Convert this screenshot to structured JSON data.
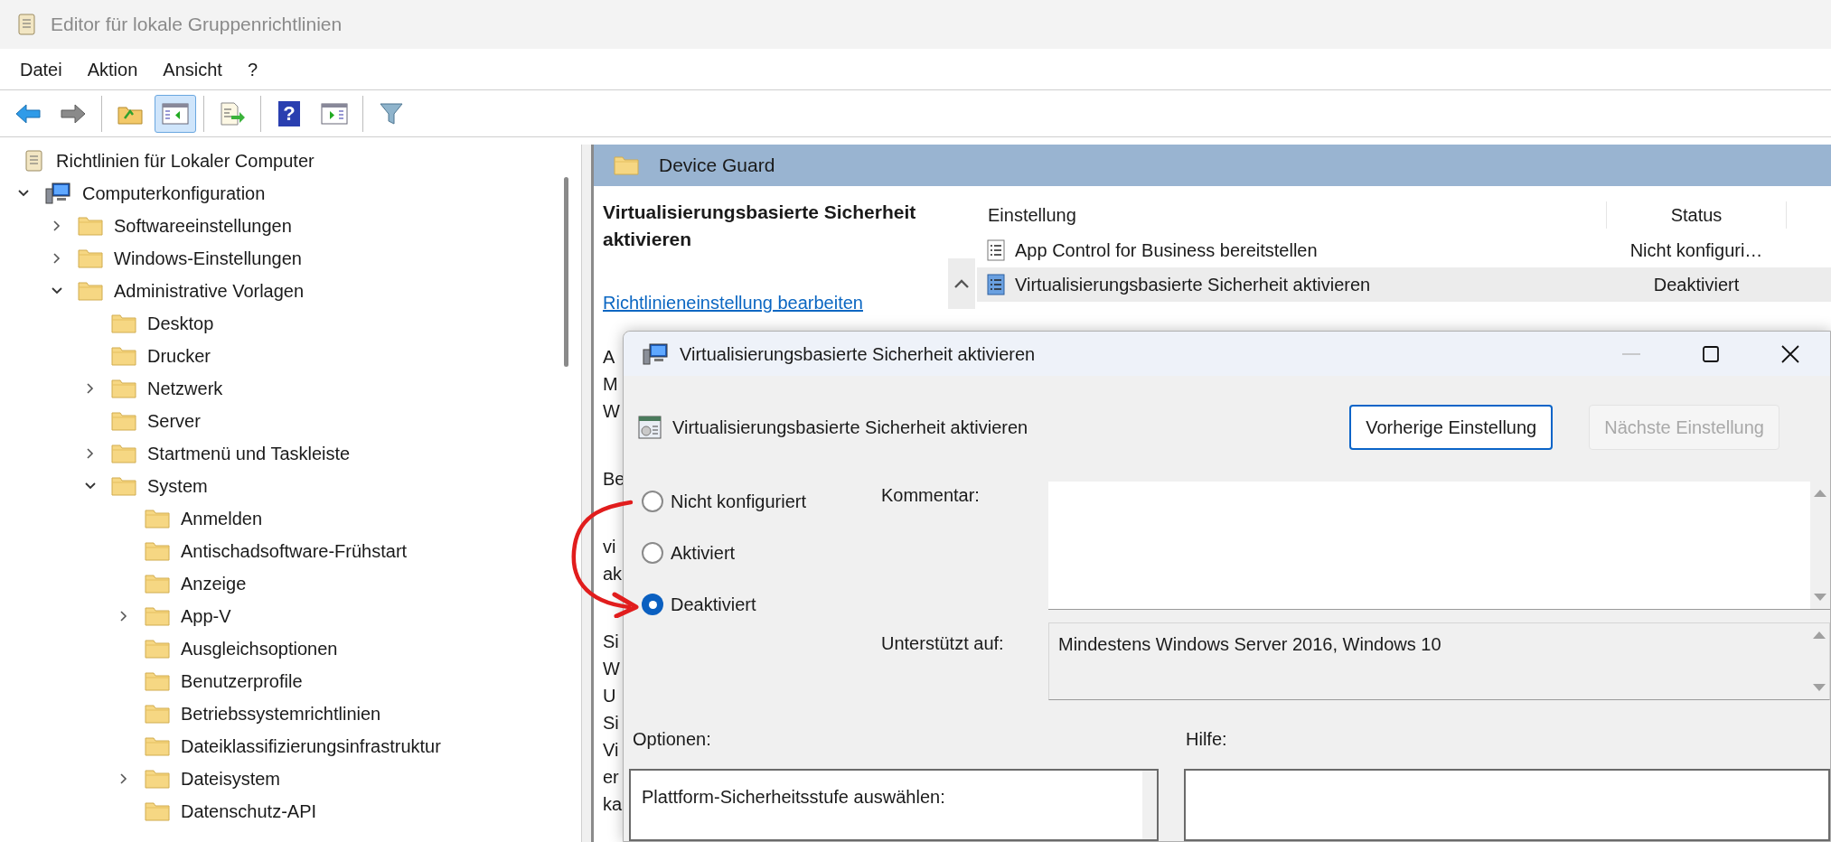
{
  "window": {
    "title": "Editor für lokale Gruppenrichtlinien"
  },
  "menu": [
    "Datei",
    "Aktion",
    "Ansicht",
    "?"
  ],
  "toolbar": [
    {
      "kind": "back",
      "selected": false
    },
    {
      "kind": "forward",
      "selected": false
    },
    {
      "kind": "separator"
    },
    {
      "kind": "folder_up",
      "selected": false
    },
    {
      "kind": "console_tree",
      "selected": true
    },
    {
      "kind": "separator"
    },
    {
      "kind": "export",
      "selected": false
    },
    {
      "kind": "separator"
    },
    {
      "kind": "help",
      "selected": false,
      "glyph": "?"
    },
    {
      "kind": "action_pane",
      "selected": false
    },
    {
      "kind": "separator"
    },
    {
      "kind": "filter",
      "selected": false
    }
  ],
  "tree": [
    {
      "label": "Richtlinien für Lokaler Computer",
      "kind": "policy",
      "children": [
        {
          "label": "Computerkonfiguration",
          "kind": "computer",
          "expanded": true,
          "children": [
            {
              "label": "Softwareeinstellungen",
              "kind": "folder",
              "expanded": false
            },
            {
              "label": "Windows-Einstellungen",
              "kind": "folder",
              "expanded": false
            },
            {
              "label": "Administrative Vorlagen",
              "kind": "folder",
              "expanded": true,
              "children": [
                {
                  "label": "Desktop",
                  "kind": "folder"
                },
                {
                  "label": "Drucker",
                  "kind": "folder"
                },
                {
                  "label": "Netzwerk",
                  "kind": "folder",
                  "expanded": false
                },
                {
                  "label": "Server",
                  "kind": "folder"
                },
                {
                  "label": "Startmenü und Taskleiste",
                  "kind": "folder",
                  "expanded": false
                },
                {
                  "label": "System",
                  "kind": "folder",
                  "expanded": true,
                  "children": [
                    {
                      "label": "Anmelden",
                      "kind": "folder"
                    },
                    {
                      "label": "Antischadsoftware-Frühstart",
                      "kind": "folder"
                    },
                    {
                      "label": "Anzeige",
                      "kind": "folder"
                    },
                    {
                      "label": "App-V",
                      "kind": "folder",
                      "expanded": false
                    },
                    {
                      "label": "Ausgleichsoptionen",
                      "kind": "folder"
                    },
                    {
                      "label": "Benutzerprofile",
                      "kind": "folder"
                    },
                    {
                      "label": "Betriebssystemrichtlinien",
                      "kind": "folder"
                    },
                    {
                      "label": "Dateiklassifizierungsinfrastruktur",
                      "kind": "folder"
                    },
                    {
                      "label": "Dateisystem",
                      "kind": "folder",
                      "expanded": false
                    },
                    {
                      "label": "Datenschutz-API",
                      "kind": "folder"
                    }
                  ]
                }
              ]
            }
          ]
        }
      ]
    }
  ],
  "details": {
    "folder": "Device Guard",
    "policy_title": "Virtualisierungsbasierte Sicherheit aktivieren",
    "edit_link": "Richtlinieneinstellung bearbeiten",
    "description_fragments": [
      [
        "A",
        "M",
        "W"
      ],
      [
        "Be"
      ],
      [
        "vi",
        "ak"
      ],
      [
        "Si",
        "W",
        "U",
        "Si",
        "Vi",
        "er",
        "ka"
      ]
    ]
  },
  "list": {
    "columns": [
      "Einstellung",
      "Status"
    ],
    "rows": [
      {
        "setting": "App Control for Business bereitstellen",
        "status": "Nicht konfiguri…",
        "selected": false
      },
      {
        "setting": "Virtualisierungsbasierte Sicherheit aktivieren",
        "status": "Deaktiviert",
        "selected": true
      }
    ]
  },
  "dialog": {
    "title": "Virtualisierungsbasierte Sicherheit aktivieren",
    "window_controls": [
      {
        "kind": "minimize",
        "disabled": true
      },
      {
        "kind": "maximize",
        "disabled": false
      },
      {
        "kind": "close",
        "disabled": false
      }
    ],
    "policy_name": "Virtualisierungsbasierte Sicherheit aktivieren",
    "buttons": [
      {
        "label": "Vorherige Einstellung",
        "disabled": false,
        "focused": true
      },
      {
        "label": "Nächste Einstellung",
        "disabled": true,
        "focused": false
      }
    ],
    "states": [
      {
        "label": "Nicht konfiguriert",
        "selected": false
      },
      {
        "label": "Aktiviert",
        "selected": false
      },
      {
        "label": "Deaktiviert",
        "selected": true
      }
    ],
    "comment_label": "Kommentar:",
    "supported_label": "Unterstützt auf:",
    "supported_value": "Mindestens Windows Server 2016, Windows 10",
    "options_label": "Optionen:",
    "help_label": "Hilfe:",
    "options_content": "Plattform-Sicherheitsstufe auswählen:"
  }
}
